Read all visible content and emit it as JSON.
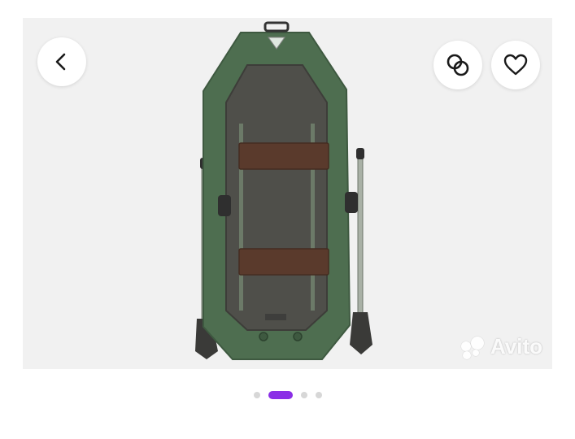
{
  "listing": {
    "photo": {
      "subject": "inflatable-rowing-boat",
      "colors": {
        "hull": "#4e6e50",
        "floor": "#4f4f4a",
        "seat": "#5a3a2c",
        "background": "#f1f1f1"
      }
    },
    "carousel": {
      "total": 4,
      "active_index": 1
    },
    "icons": {
      "back": "chevron-left-icon",
      "compare": "compare-icon",
      "favorite": "heart-icon"
    },
    "accent": "#8a2ee6",
    "watermark_brand": "Avito"
  }
}
